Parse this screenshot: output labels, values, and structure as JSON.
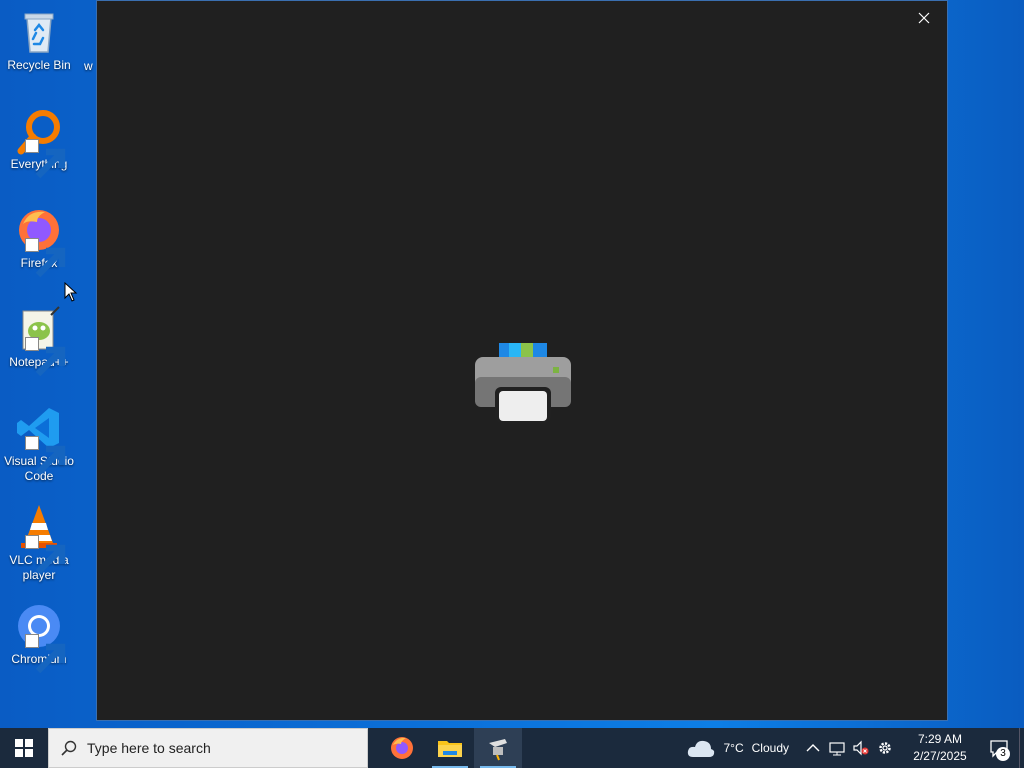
{
  "desktop": {
    "icons": [
      {
        "label": "Recycle Bin"
      },
      {
        "label": "Everything"
      },
      {
        "label": "Firefox"
      },
      {
        "label": "Notepad++"
      },
      {
        "label": "Visual Studio Code"
      },
      {
        "label": "VLC media player"
      },
      {
        "label": "Chromium"
      }
    ],
    "partial_label": "w"
  },
  "window": {
    "background_color": "#202020",
    "close_icon": "close-icon",
    "center_icon": "printer-icon"
  },
  "taskbar": {
    "search_placeholder": "Type here to search",
    "apps": [
      "firefox-icon",
      "file-explorer-icon",
      "printer-app-icon"
    ],
    "weather": {
      "temp": "7°C",
      "condition": "Cloudy"
    },
    "time": "7:29 AM",
    "date": "2/27/2025",
    "notification_count": "3"
  },
  "colors": {
    "taskbar_bg": "#1b2a3d",
    "desktop_blue": "#0b6fd8",
    "accent": "#76b9ed"
  }
}
